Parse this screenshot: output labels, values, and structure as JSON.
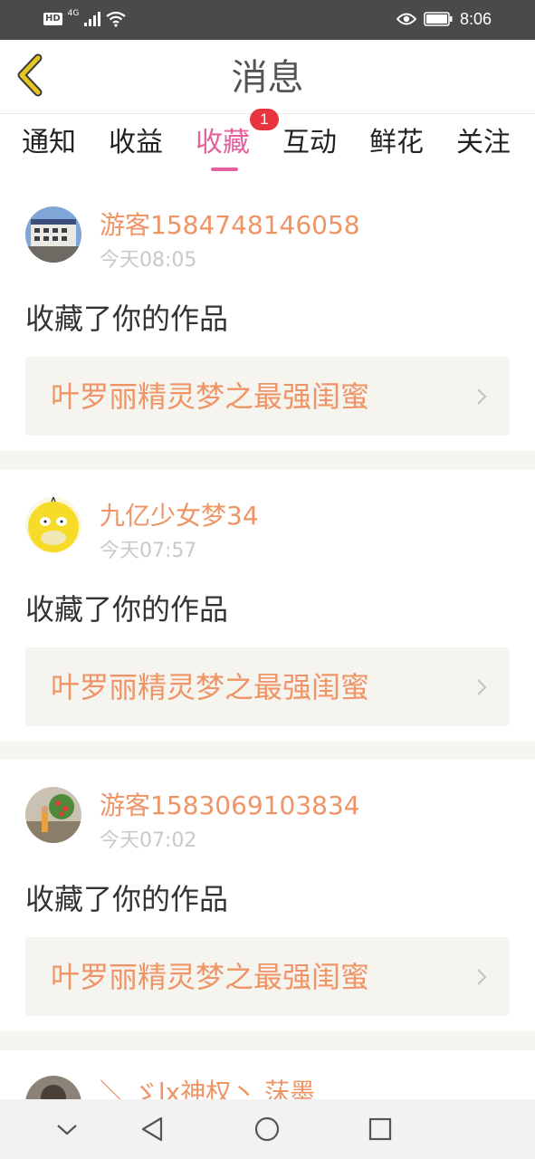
{
  "status_bar": {
    "hd": "HD",
    "network": "4G",
    "time": "8:06",
    "icons": [
      "signal-icon",
      "wifi-icon",
      "eye-icon",
      "battery-icon"
    ]
  },
  "header": {
    "title": "消息",
    "back_icon": "chevron-left-icon"
  },
  "tabs": [
    {
      "label": "通知"
    },
    {
      "label": "收益"
    },
    {
      "label": "收藏",
      "active": true,
      "badge": "1"
    },
    {
      "label": "互动"
    },
    {
      "label": "鲜花"
    },
    {
      "label": "关注"
    }
  ],
  "messages": [
    {
      "username": "游客1584748146058",
      "time": "今天08:05",
      "action": "收藏了你的作品",
      "work_title": "叶罗丽精灵梦之最强闺蜜"
    },
    {
      "username": "九亿少女梦34",
      "time": "今天07:57",
      "action": "收藏了你的作品",
      "work_title": "叶罗丽精灵梦之最强闺蜜"
    },
    {
      "username": "游客1583069103834",
      "time": "今天07:02",
      "action": "收藏了你的作品",
      "work_title": "叶罗丽精灵梦之最强闺蜜"
    },
    {
      "username": "＼ ゞlx神权丶 莯墨"
    }
  ],
  "colors": {
    "accent_pink": "#e5609d",
    "username_orange": "#ee9466",
    "badge_red": "#e8343f",
    "back_arrow_yellow": "#e7c521"
  },
  "nav_bar": {
    "icons": [
      "chevron-down-icon",
      "back-triangle-icon",
      "home-circle-icon",
      "recents-square-icon"
    ]
  }
}
